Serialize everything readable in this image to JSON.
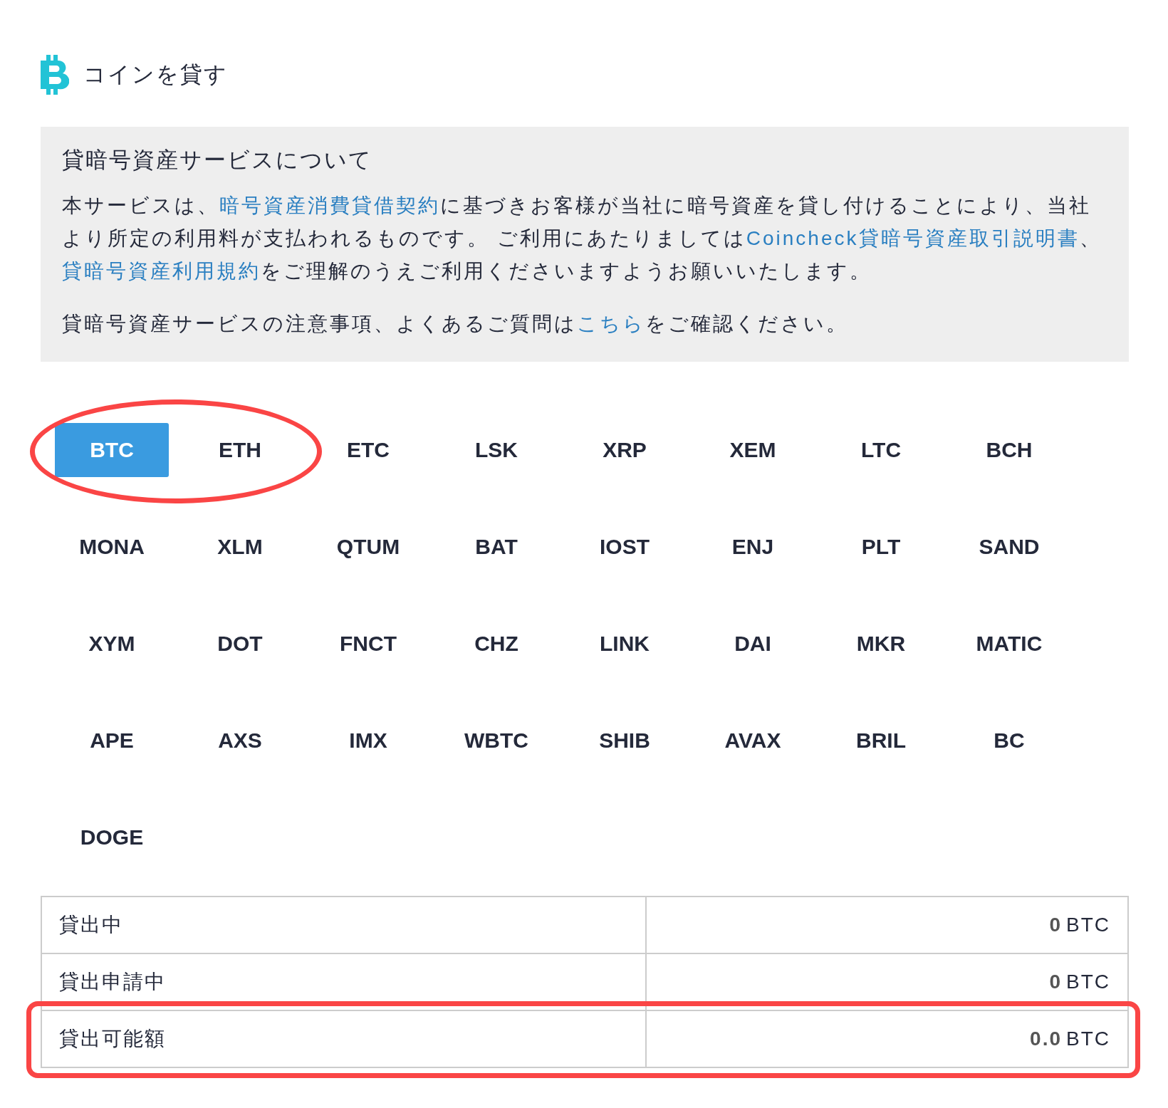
{
  "header": {
    "title": "コインを貸す"
  },
  "notice": {
    "title": "貸暗号資産サービスについて",
    "paragraphs": [
      [
        {
          "text": "本サービスは、",
          "link": false
        },
        {
          "text": "暗号資産消費貸借契約",
          "link": true
        },
        {
          "text": "に基づきお客様が当社に暗号資産を貸し付けることにより、当社より所定の利用料が支払われるものです。 ご利用にあたりましては",
          "link": false
        },
        {
          "text": "Coincheck貸暗号資産取引説明書",
          "link": true
        },
        {
          "text": "、",
          "link": false
        },
        {
          "text": "貸暗号資産利用規約",
          "link": true
        },
        {
          "text": "をご理解のうえご利用くださいますようお願いいたします。",
          "link": false
        }
      ],
      [
        {
          "text": "貸暗号資産サービスの注意事項、よくあるご質問は",
          "link": false
        },
        {
          "text": "こちら",
          "link": true
        },
        {
          "text": "をご確認ください。",
          "link": false
        }
      ]
    ]
  },
  "coins": [
    {
      "label": "BTC",
      "selected": true,
      "circled": true
    },
    {
      "label": "ETH",
      "selected": false,
      "circled": true
    },
    {
      "label": "ETC",
      "selected": false,
      "circled": false
    },
    {
      "label": "LSK",
      "selected": false,
      "circled": false
    },
    {
      "label": "XRP",
      "selected": false,
      "circled": false
    },
    {
      "label": "XEM",
      "selected": false,
      "circled": false
    },
    {
      "label": "LTC",
      "selected": false,
      "circled": false
    },
    {
      "label": "BCH",
      "selected": false,
      "circled": false
    },
    {
      "label": "MONA",
      "selected": false,
      "circled": false
    },
    {
      "label": "XLM",
      "selected": false,
      "circled": false
    },
    {
      "label": "QTUM",
      "selected": false,
      "circled": false
    },
    {
      "label": "BAT",
      "selected": false,
      "circled": false
    },
    {
      "label": "IOST",
      "selected": false,
      "circled": false
    },
    {
      "label": "ENJ",
      "selected": false,
      "circled": false
    },
    {
      "label": "PLT",
      "selected": false,
      "circled": false
    },
    {
      "label": "SAND",
      "selected": false,
      "circled": false
    },
    {
      "label": "XYM",
      "selected": false,
      "circled": false
    },
    {
      "label": "DOT",
      "selected": false,
      "circled": false
    },
    {
      "label": "FNCT",
      "selected": false,
      "circled": false
    },
    {
      "label": "CHZ",
      "selected": false,
      "circled": false
    },
    {
      "label": "LINK",
      "selected": false,
      "circled": false
    },
    {
      "label": "DAI",
      "selected": false,
      "circled": false
    },
    {
      "label": "MKR",
      "selected": false,
      "circled": false
    },
    {
      "label": "MATIC",
      "selected": false,
      "circled": false
    },
    {
      "label": "APE",
      "selected": false,
      "circled": false
    },
    {
      "label": "AXS",
      "selected": false,
      "circled": false
    },
    {
      "label": "IMX",
      "selected": false,
      "circled": false
    },
    {
      "label": "WBTC",
      "selected": false,
      "circled": false
    },
    {
      "label": "SHIB",
      "selected": false,
      "circled": false
    },
    {
      "label": "AVAX",
      "selected": false,
      "circled": false
    },
    {
      "label": "BRIL",
      "selected": false,
      "circled": false
    },
    {
      "label": "BC",
      "selected": false,
      "circled": false
    },
    {
      "label": "DOGE",
      "selected": false,
      "circled": false
    }
  ],
  "balances": [
    {
      "label": "貸出中",
      "amount": "0",
      "unit": "BTC",
      "boxed": false
    },
    {
      "label": "貸出申請中",
      "amount": "0",
      "unit": "BTC",
      "boxed": false
    },
    {
      "label": "貸出可能額",
      "amount": "0.0",
      "unit": "BTC",
      "boxed": true
    }
  ]
}
